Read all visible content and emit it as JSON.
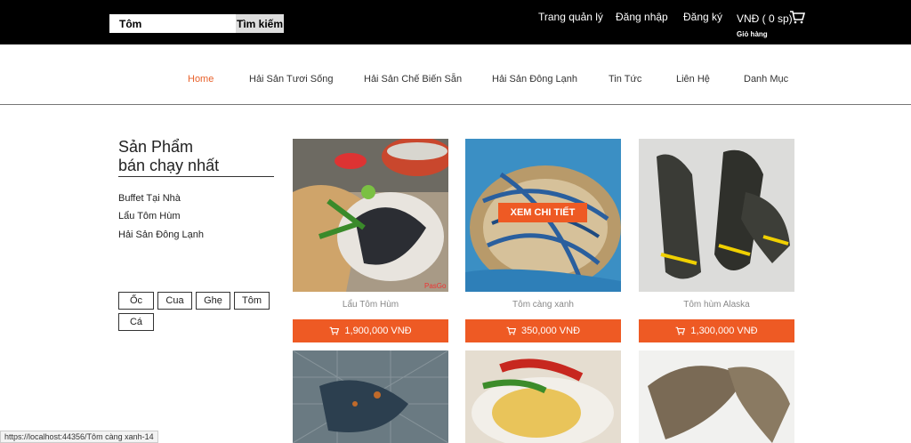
{
  "topbar": {
    "search_value": "Tôm",
    "search_button": "Tìm kiếm",
    "links": {
      "admin": "Trang quản lý",
      "login": "Đăng nhập",
      "register": "Đăng ký"
    },
    "cart": {
      "summary": "VNĐ ( 0 sp)",
      "label": "Giỏ hàng"
    }
  },
  "nav": {
    "home": "Home",
    "live": "Hải Sản Tươi Sống",
    "processed": "Hải Sản Chế Biến Sẵn",
    "frozen": "Hải Sản Đông Lạnh",
    "news": "Tin Tức",
    "contact": "Liên Hệ",
    "category": "Danh Mục"
  },
  "sidebar": {
    "title_line1": "Sản Phẩm",
    "title_line2": "bán chạy nhất",
    "links": [
      "Buffet Tại Nhà",
      "Lẩu Tôm Hùm",
      "Hải Sản Đông Lạnh"
    ],
    "tags": [
      "Ốc",
      "Cua",
      "Ghẹ",
      "Tôm",
      "Cá"
    ]
  },
  "products": [
    {
      "name": "Lẩu Tôm Hùm",
      "price": "1,900,000 VNĐ"
    },
    {
      "name": "Tôm càng xanh",
      "price": "350,000 VNĐ",
      "hover_label": "XEM CHI TIẾT"
    },
    {
      "name": "Tôm hùm Alaska",
      "price": "1,300,000 VNĐ"
    }
  ],
  "status_url": "https://localhost:44356/Tôm càng xanh-14",
  "colors": {
    "accent": "#ee5a24",
    "topbar": "#000000"
  }
}
